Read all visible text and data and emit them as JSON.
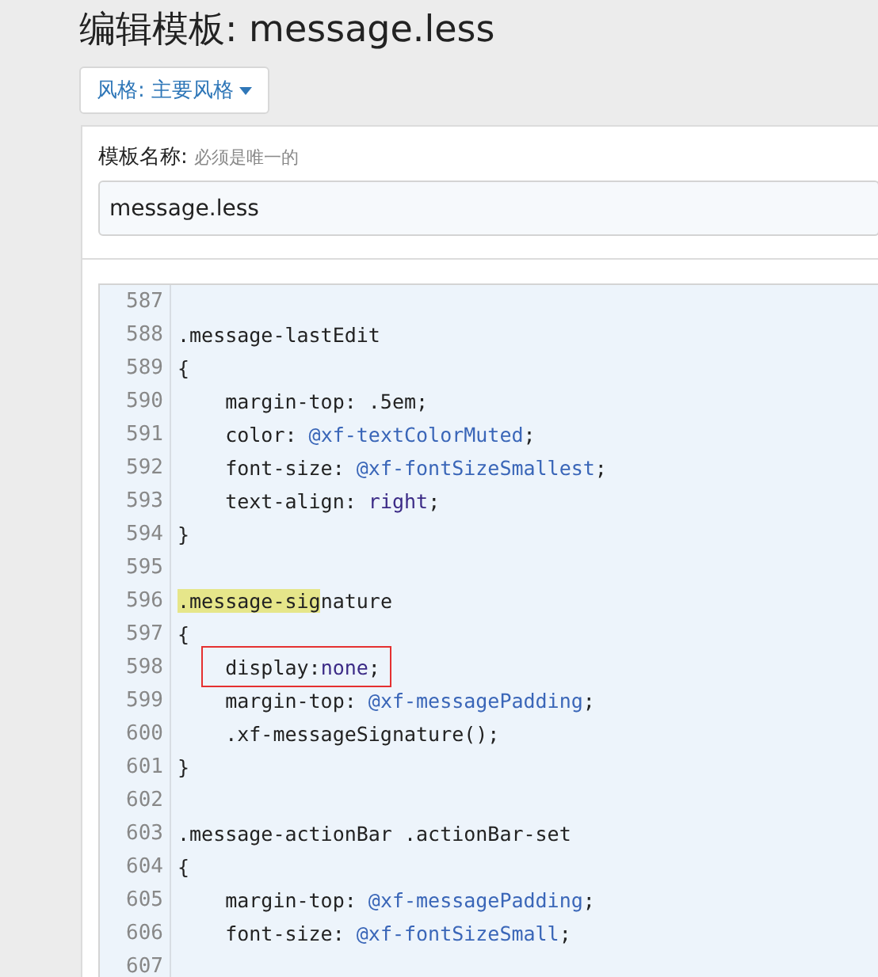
{
  "title": "编辑模板: message.less",
  "style_button": {
    "label": "风格: 主要风格"
  },
  "template_name": {
    "label": "模板名称:",
    "hint": "必须是唯一的",
    "value": "message.less"
  },
  "code_lines": [
    {
      "number": "587"
    },
    {
      "number": "588",
      "tokens": [
        {
          "kind": "plain",
          "text": ".message-lastEdit"
        }
      ]
    },
    {
      "number": "589",
      "tokens": [
        {
          "kind": "plain",
          "text": "{"
        }
      ]
    },
    {
      "number": "590",
      "tokens": [
        {
          "kind": "plain",
          "text": "    margin-top: .5em;"
        }
      ]
    },
    {
      "number": "591",
      "tokens": [
        {
          "kind": "plain",
          "text": "    color: "
        },
        {
          "kind": "variable",
          "text": "@xf-textColorMuted"
        },
        {
          "kind": "plain",
          "text": ";"
        }
      ]
    },
    {
      "number": "592",
      "tokens": [
        {
          "kind": "plain",
          "text": "    font-size: "
        },
        {
          "kind": "variable",
          "text": "@xf-fontSizeSmallest"
        },
        {
          "kind": "plain",
          "text": ";"
        }
      ]
    },
    {
      "number": "593",
      "tokens": [
        {
          "kind": "plain",
          "text": "    text-align: "
        },
        {
          "kind": "keyword",
          "text": "right"
        },
        {
          "kind": "plain",
          "text": ";"
        }
      ]
    },
    {
      "number": "594",
      "tokens": [
        {
          "kind": "plain",
          "text": "}"
        }
      ]
    },
    {
      "number": "595"
    },
    {
      "number": "596",
      "tokens": [
        {
          "kind": "match",
          "text": ".message-sig"
        },
        {
          "kind": "plain",
          "text": "nature"
        }
      ]
    },
    {
      "number": "597",
      "tokens": [
        {
          "kind": "plain",
          "text": "{"
        }
      ]
    },
    {
      "number": "598",
      "annotated": true,
      "tokens": [
        {
          "kind": "plain",
          "text": "    display:"
        },
        {
          "kind": "keyword",
          "text": "none"
        },
        {
          "kind": "plain",
          "text": ";"
        }
      ]
    },
    {
      "number": "599",
      "tokens": [
        {
          "kind": "plain",
          "text": "    margin-top: "
        },
        {
          "kind": "variable",
          "text": "@xf-messagePadding"
        },
        {
          "kind": "plain",
          "text": ";"
        }
      ]
    },
    {
      "number": "600",
      "tokens": [
        {
          "kind": "plain",
          "text": "    .xf-messageSignature();"
        }
      ]
    },
    {
      "number": "601",
      "tokens": [
        {
          "kind": "plain",
          "text": "}"
        }
      ]
    },
    {
      "number": "602"
    },
    {
      "number": "603",
      "tokens": [
        {
          "kind": "plain",
          "text": ".message-actionBar .actionBar-set"
        }
      ]
    },
    {
      "number": "604",
      "tokens": [
        {
          "kind": "plain",
          "text": "{"
        }
      ]
    },
    {
      "number": "605",
      "tokens": [
        {
          "kind": "plain",
          "text": "    margin-top: "
        },
        {
          "kind": "variable",
          "text": "@xf-messagePadding"
        },
        {
          "kind": "plain",
          "text": ";"
        }
      ]
    },
    {
      "number": "606",
      "tokens": [
        {
          "kind": "plain",
          "text": "    font-size: "
        },
        {
          "kind": "variable",
          "text": "@xf-fontSizeSmall"
        },
        {
          "kind": "plain",
          "text": ";"
        }
      ]
    },
    {
      "number": "607"
    }
  ]
}
